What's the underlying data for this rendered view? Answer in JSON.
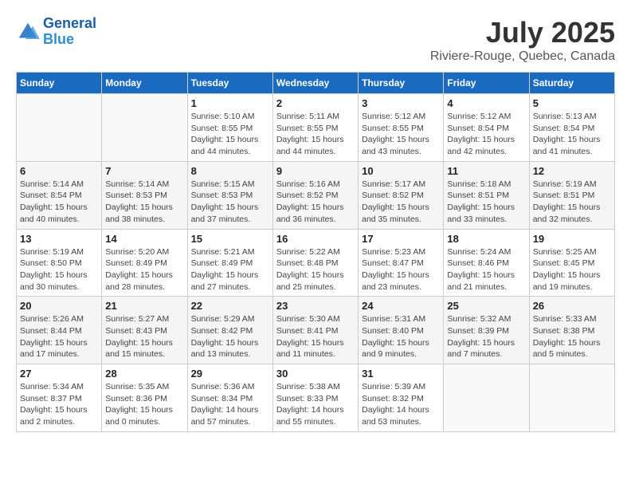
{
  "header": {
    "logo_line1": "General",
    "logo_line2": "Blue",
    "month_year": "July 2025",
    "location": "Riviere-Rouge, Quebec, Canada"
  },
  "weekdays": [
    "Sunday",
    "Monday",
    "Tuesday",
    "Wednesday",
    "Thursday",
    "Friday",
    "Saturday"
  ],
  "weeks": [
    [
      {
        "day": "",
        "info": ""
      },
      {
        "day": "",
        "info": ""
      },
      {
        "day": "1",
        "info": "Sunrise: 5:10 AM\nSunset: 8:55 PM\nDaylight: 15 hours and 44 minutes."
      },
      {
        "day": "2",
        "info": "Sunrise: 5:11 AM\nSunset: 8:55 PM\nDaylight: 15 hours and 44 minutes."
      },
      {
        "day": "3",
        "info": "Sunrise: 5:12 AM\nSunset: 8:55 PM\nDaylight: 15 hours and 43 minutes."
      },
      {
        "day": "4",
        "info": "Sunrise: 5:12 AM\nSunset: 8:54 PM\nDaylight: 15 hours and 42 minutes."
      },
      {
        "day": "5",
        "info": "Sunrise: 5:13 AM\nSunset: 8:54 PM\nDaylight: 15 hours and 41 minutes."
      }
    ],
    [
      {
        "day": "6",
        "info": "Sunrise: 5:14 AM\nSunset: 8:54 PM\nDaylight: 15 hours and 40 minutes."
      },
      {
        "day": "7",
        "info": "Sunrise: 5:14 AM\nSunset: 8:53 PM\nDaylight: 15 hours and 38 minutes."
      },
      {
        "day": "8",
        "info": "Sunrise: 5:15 AM\nSunset: 8:53 PM\nDaylight: 15 hours and 37 minutes."
      },
      {
        "day": "9",
        "info": "Sunrise: 5:16 AM\nSunset: 8:52 PM\nDaylight: 15 hours and 36 minutes."
      },
      {
        "day": "10",
        "info": "Sunrise: 5:17 AM\nSunset: 8:52 PM\nDaylight: 15 hours and 35 minutes."
      },
      {
        "day": "11",
        "info": "Sunrise: 5:18 AM\nSunset: 8:51 PM\nDaylight: 15 hours and 33 minutes."
      },
      {
        "day": "12",
        "info": "Sunrise: 5:19 AM\nSunset: 8:51 PM\nDaylight: 15 hours and 32 minutes."
      }
    ],
    [
      {
        "day": "13",
        "info": "Sunrise: 5:19 AM\nSunset: 8:50 PM\nDaylight: 15 hours and 30 minutes."
      },
      {
        "day": "14",
        "info": "Sunrise: 5:20 AM\nSunset: 8:49 PM\nDaylight: 15 hours and 28 minutes."
      },
      {
        "day": "15",
        "info": "Sunrise: 5:21 AM\nSunset: 8:49 PM\nDaylight: 15 hours and 27 minutes."
      },
      {
        "day": "16",
        "info": "Sunrise: 5:22 AM\nSunset: 8:48 PM\nDaylight: 15 hours and 25 minutes."
      },
      {
        "day": "17",
        "info": "Sunrise: 5:23 AM\nSunset: 8:47 PM\nDaylight: 15 hours and 23 minutes."
      },
      {
        "day": "18",
        "info": "Sunrise: 5:24 AM\nSunset: 8:46 PM\nDaylight: 15 hours and 21 minutes."
      },
      {
        "day": "19",
        "info": "Sunrise: 5:25 AM\nSunset: 8:45 PM\nDaylight: 15 hours and 19 minutes."
      }
    ],
    [
      {
        "day": "20",
        "info": "Sunrise: 5:26 AM\nSunset: 8:44 PM\nDaylight: 15 hours and 17 minutes."
      },
      {
        "day": "21",
        "info": "Sunrise: 5:27 AM\nSunset: 8:43 PM\nDaylight: 15 hours and 15 minutes."
      },
      {
        "day": "22",
        "info": "Sunrise: 5:29 AM\nSunset: 8:42 PM\nDaylight: 15 hours and 13 minutes."
      },
      {
        "day": "23",
        "info": "Sunrise: 5:30 AM\nSunset: 8:41 PM\nDaylight: 15 hours and 11 minutes."
      },
      {
        "day": "24",
        "info": "Sunrise: 5:31 AM\nSunset: 8:40 PM\nDaylight: 15 hours and 9 minutes."
      },
      {
        "day": "25",
        "info": "Sunrise: 5:32 AM\nSunset: 8:39 PM\nDaylight: 15 hours and 7 minutes."
      },
      {
        "day": "26",
        "info": "Sunrise: 5:33 AM\nSunset: 8:38 PM\nDaylight: 15 hours and 5 minutes."
      }
    ],
    [
      {
        "day": "27",
        "info": "Sunrise: 5:34 AM\nSunset: 8:37 PM\nDaylight: 15 hours and 2 minutes."
      },
      {
        "day": "28",
        "info": "Sunrise: 5:35 AM\nSunset: 8:36 PM\nDaylight: 15 hours and 0 minutes."
      },
      {
        "day": "29",
        "info": "Sunrise: 5:36 AM\nSunset: 8:34 PM\nDaylight: 14 hours and 57 minutes."
      },
      {
        "day": "30",
        "info": "Sunrise: 5:38 AM\nSunset: 8:33 PM\nDaylight: 14 hours and 55 minutes."
      },
      {
        "day": "31",
        "info": "Sunrise: 5:39 AM\nSunset: 8:32 PM\nDaylight: 14 hours and 53 minutes."
      },
      {
        "day": "",
        "info": ""
      },
      {
        "day": "",
        "info": ""
      }
    ]
  ]
}
